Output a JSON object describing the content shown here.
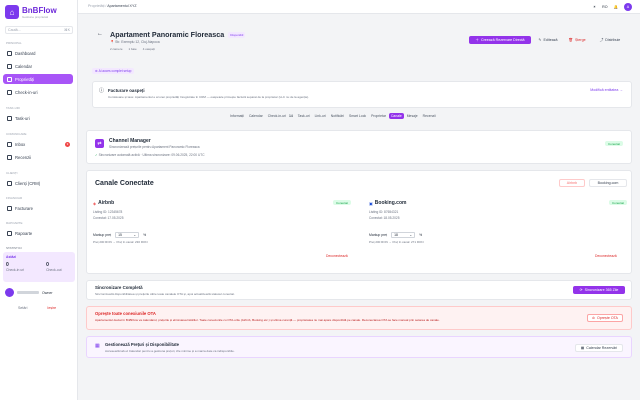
{
  "brand": {
    "name": "BnBFlow",
    "sub": "Gestiune proprietati"
  },
  "search": {
    "placeholder": "Caută...",
    "shortcut": "⌘K"
  },
  "sidebar": {
    "sections": [
      "Principal",
      "Task-uri",
      "Comunicare",
      "Clienți",
      "Financiar",
      "Rapoarte",
      "Statistici"
    ],
    "items": [
      {
        "label": "Dashboard"
      },
      {
        "label": "Calendar"
      },
      {
        "label": "Proprietăți"
      },
      {
        "label": "Check-in-uri"
      },
      {
        "label": "Task-uri"
      },
      {
        "label": "Inbox",
        "badge": "3"
      },
      {
        "label": "Recenzii"
      },
      {
        "label": "Clienți (CRM)"
      },
      {
        "label": "Facturare"
      },
      {
        "label": "Rapoarte"
      }
    ],
    "stats_title": "Astăzi",
    "stats": [
      {
        "value": "0",
        "label": "Check-in uri"
      },
      {
        "value": "0",
        "label": "Check-out"
      }
    ],
    "user_role": "Owner",
    "settings": "Setări",
    "logout": "Ieșire"
  },
  "topbar": {
    "crumb1": "Proprietăți",
    "crumb2": "Apartamentul XYZ",
    "lang": "RO",
    "avatar": "A"
  },
  "property": {
    "title": "Apartament Panoramic Floreasca",
    "status": "Disponibil",
    "address": "Str. Exemplu 12, Cluj-Napoca",
    "meta": [
      "2 camere",
      "1 baie",
      "4 oaspeți"
    ],
    "btn_reserve": "Creează Rezervare Directă",
    "btn_edit": "Editează",
    "btn_delete": "Șterge",
    "btn_share": "Distribuie",
    "setup_note": "Ai acces complet setup"
  },
  "invoice": {
    "title": "Facturare oaspeți",
    "text": "Comisioane și taxe: Apartamentul e al unei proprietăți înregistrate în CRM — oaspetele primește factură separat de la proprietar (LLC nu de la agenție).",
    "link": "Modifică entitatea"
  },
  "tabs": [
    {
      "label": "Informații"
    },
    {
      "label": "Calendar"
    },
    {
      "label": "Check-in-uri",
      "count": "14"
    },
    {
      "label": "Task-uri"
    },
    {
      "label": "Link-uri"
    },
    {
      "label": "Notificări"
    },
    {
      "label": "Smart Lock"
    },
    {
      "label": "Proprietar"
    },
    {
      "label": "Canale"
    },
    {
      "label": "Mesaje"
    },
    {
      "label": "Recenzii"
    }
  ],
  "channel_manager": {
    "title": "Channel Manager",
    "subtitle": "Sincronizează prețurile pentru Apartament Panoramic Floreasca",
    "status": "Conectat",
    "sync": "Sincronizare automată activă · Ultima sincronizare: 09.06.2025, 22:00 UTC"
  },
  "channels": {
    "title": "Canale Conectate",
    "filter1": "Airbnb",
    "filter2": "Booking.com",
    "items": [
      {
        "name": "Airbnb",
        "status": "Conectat",
        "listing": "Listing ID: 12345678",
        "connected": "Conectat: 17.05.2025",
        "markup_label": "Markup preț",
        "markup_value": "15",
        "unit": "%",
        "example": "Preț 200 RON → Preț în canal: 230 RON",
        "disconnect": "Deconectează"
      },
      {
        "name": "Booking.com",
        "status": "Conectat",
        "listing": "Listing ID: 87654321",
        "connected": "Conectat: 18.05.2025",
        "markup_label": "Markup preț",
        "markup_value": "18",
        "unit": "%",
        "example": "Preț 200 RON → Preț în canal: 271 RON",
        "disconnect": "Deconectează"
      }
    ]
  },
  "sync_full": {
    "title": "Sincronizare Completă",
    "text": "Sincronizează disponibilitatea și prețurile către toate canalele OTA și, apoi actualizează statusul conectat.",
    "btn": "Sincronizare 365 Zile"
  },
  "stop_ota": {
    "title": "Oprește toate conexiunile OTA",
    "text": "Apartamentul deviat în BnBFlow va calendarul, prețurile și eliminarea listărilor. Toate conexiunile cu OTA-urile (Airbnb, Booking etc.) și ultima curență — proprietatea nu mai apare disponibilă pe canale. Reconectarea OTA se face manual prin setarea de canale.",
    "btn": "Oprește OTA"
  },
  "price_mgmt": {
    "title": "Gestionează Prețuri și Disponibilitate",
    "text": "Accesează tab-ul Calendar pentru a gestiona prețuri, zile minime și a marca date ca indisponibile.",
    "btn": "Calendar Rezervări"
  }
}
